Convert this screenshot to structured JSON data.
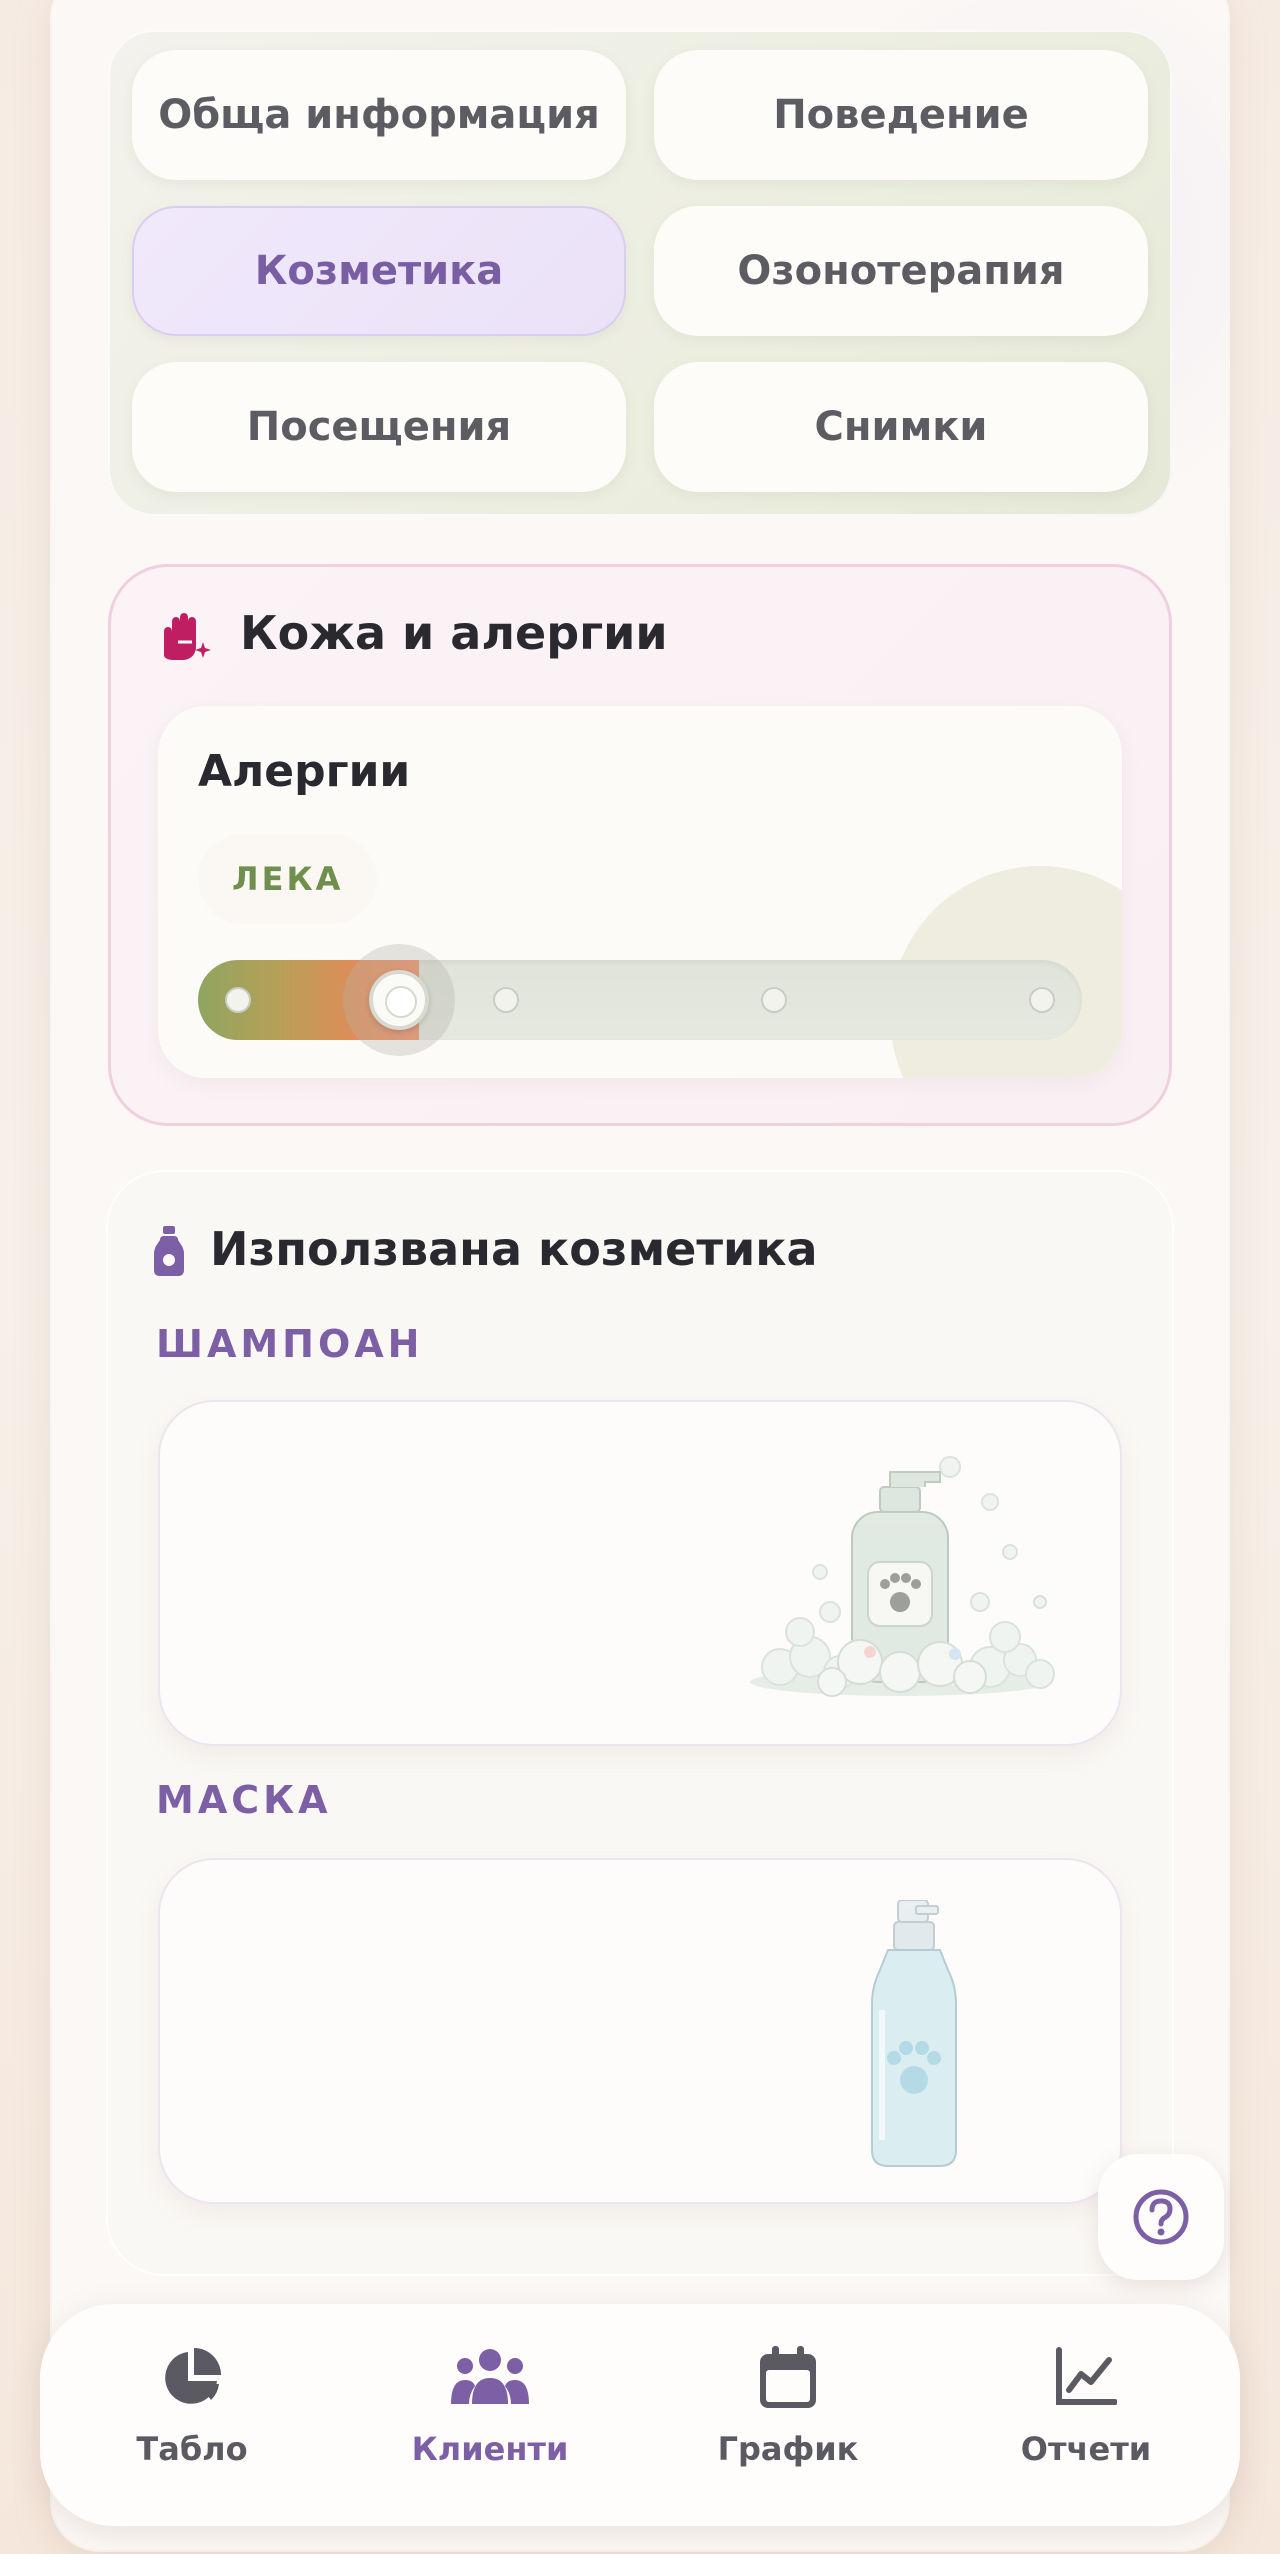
{
  "tabs": [
    {
      "label": "Обща информация",
      "active": false
    },
    {
      "label": "Поведение",
      "active": false
    },
    {
      "label": "Козметика",
      "active": true
    },
    {
      "label": "Озонотерапия",
      "active": false
    },
    {
      "label": "Посещения",
      "active": false
    },
    {
      "label": "Снимки",
      "active": false
    }
  ],
  "skin_section": {
    "title": "Кожа и алергии",
    "icon": "hand-sparkle-icon",
    "allergies": {
      "label": "Алергии",
      "level_label": "ЛЕКА",
      "slider": {
        "steps": 4,
        "selected_step": 2
      }
    }
  },
  "cosmetics_section": {
    "title": "Използвана козметика",
    "icon": "bottle-icon",
    "categories": [
      {
        "label": "ШАМПОАН",
        "illustration": "shampoo-bottle-illustration"
      },
      {
        "label": "МАСКА",
        "illustration": "spray-bottle-illustration"
      }
    ]
  },
  "help_button": {
    "icon": "help-icon"
  },
  "bottom_nav": [
    {
      "label": "Табло",
      "icon": "pie-chart-icon",
      "active": false
    },
    {
      "label": "Клиенти",
      "icon": "users-icon",
      "active": true
    },
    {
      "label": "График",
      "icon": "calendar-icon",
      "active": false
    },
    {
      "label": "Отчети",
      "icon": "line-chart-icon",
      "active": false
    }
  ],
  "colors": {
    "accent": "#7d5fa5",
    "allergy_accent": "#c01e62",
    "level_green": "#6e8f4e"
  }
}
